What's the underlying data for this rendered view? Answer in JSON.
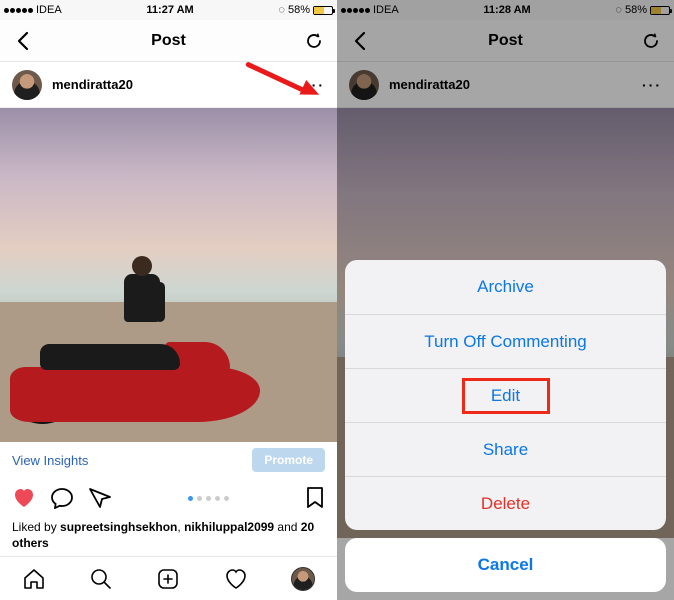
{
  "status": {
    "carrier": "IDEA",
    "time_left": "11:27 AM",
    "time_right": "11:28 AM",
    "battery_pct": "58%",
    "loading_glyph": "◌"
  },
  "nav": {
    "title": "Post"
  },
  "profile": {
    "username": "mendiratta20"
  },
  "insights": {
    "link": "View Insights",
    "promote": "Promote"
  },
  "likes": {
    "prefix": "Liked by ",
    "user1": "supreetsinghsekhon",
    "sep": ", ",
    "user2": "nikhiluppal2099",
    "and": " and ",
    "count": "20 others"
  },
  "sheet": {
    "archive": "Archive",
    "turn_off": "Turn Off Commenting",
    "edit": "Edit",
    "share": "Share",
    "delete": "Delete",
    "cancel": "Cancel"
  }
}
